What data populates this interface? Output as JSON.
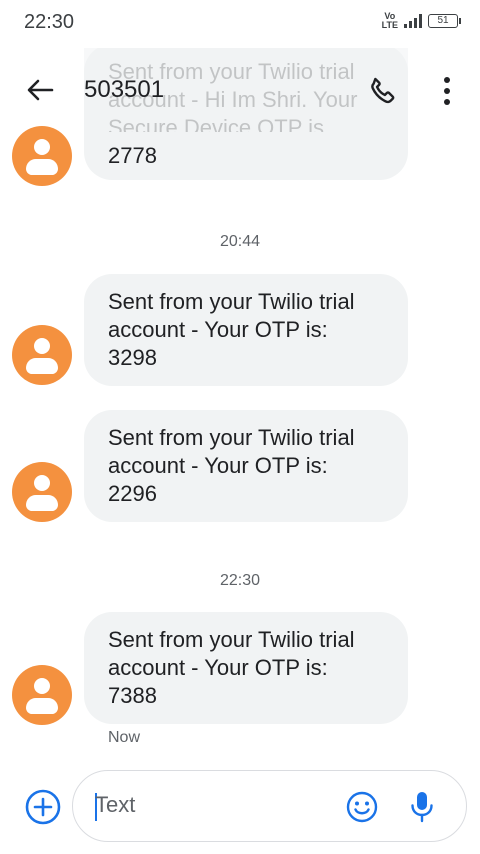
{
  "status_bar": {
    "time": "22:30",
    "volte_top": "Vo",
    "volte_bottom": "LTE",
    "battery": "51"
  },
  "header": {
    "title": "503501",
    "behind_text_1": "Sent from your Twilio trial",
    "behind_text_2": "account - Hi Im Shri. Your",
    "behind_text_3": "Secure Device OTP is"
  },
  "messages": [
    {
      "lines": [
        "2778"
      ]
    },
    {
      "timestamp": "20:44"
    },
    {
      "lines": [
        "Sent from your Twilio trial",
        "account - Your OTP is:",
        "3298"
      ]
    },
    {
      "lines": [
        "Sent from your Twilio trial",
        "account - Your OTP is:",
        "2296"
      ]
    },
    {
      "timestamp": "22:30"
    },
    {
      "lines": [
        "Sent from your Twilio trial",
        "account - Your OTP is:",
        "7388"
      ],
      "status": "Now"
    }
  ],
  "compose": {
    "placeholder": "Text"
  },
  "colors": {
    "avatar": "#f4913f",
    "bubble": "#f1f3f4",
    "accent": "#1a73e8"
  },
  "icons": [
    "back-arrow-icon",
    "phone-icon",
    "more-vert-icon",
    "person-icon",
    "add-circle-icon",
    "emoji-icon",
    "mic-icon"
  ]
}
